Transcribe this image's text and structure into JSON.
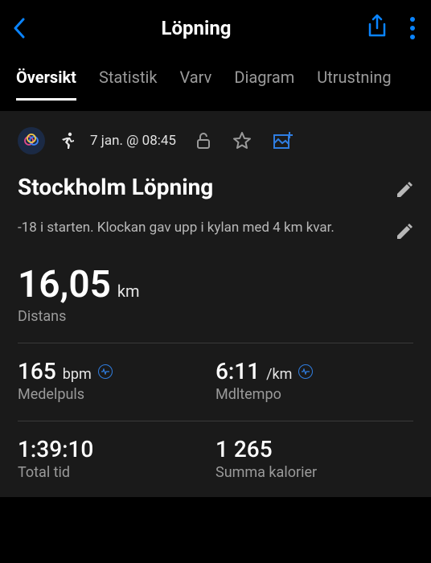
{
  "header": {
    "title": "Löpning"
  },
  "tabs": [
    {
      "label": "Översikt",
      "active": true
    },
    {
      "label": "Statistik",
      "active": false
    },
    {
      "label": "Varv",
      "active": false
    },
    {
      "label": "Diagram",
      "active": false
    },
    {
      "label": "Utrustning",
      "active": false
    }
  ],
  "activity": {
    "datetime": "7 jan. @ 08:45",
    "title": "Stockholm Löpning",
    "notes": "-18 i starten. Klockan gav upp i kylan med 4 km kvar."
  },
  "stats": {
    "distance": {
      "value": "16,05",
      "unit": "km",
      "label": "Distans"
    },
    "avg_hr": {
      "value": "165",
      "unit": "bpm",
      "label": "Medelpuls"
    },
    "avg_pace": {
      "value": "6:11",
      "unit": "/km",
      "label": "Mdltempo"
    },
    "total_time": {
      "value": "1:39:10",
      "label": "Total tid"
    },
    "calories": {
      "value": "1 265",
      "label": "Summa kalorier"
    }
  }
}
